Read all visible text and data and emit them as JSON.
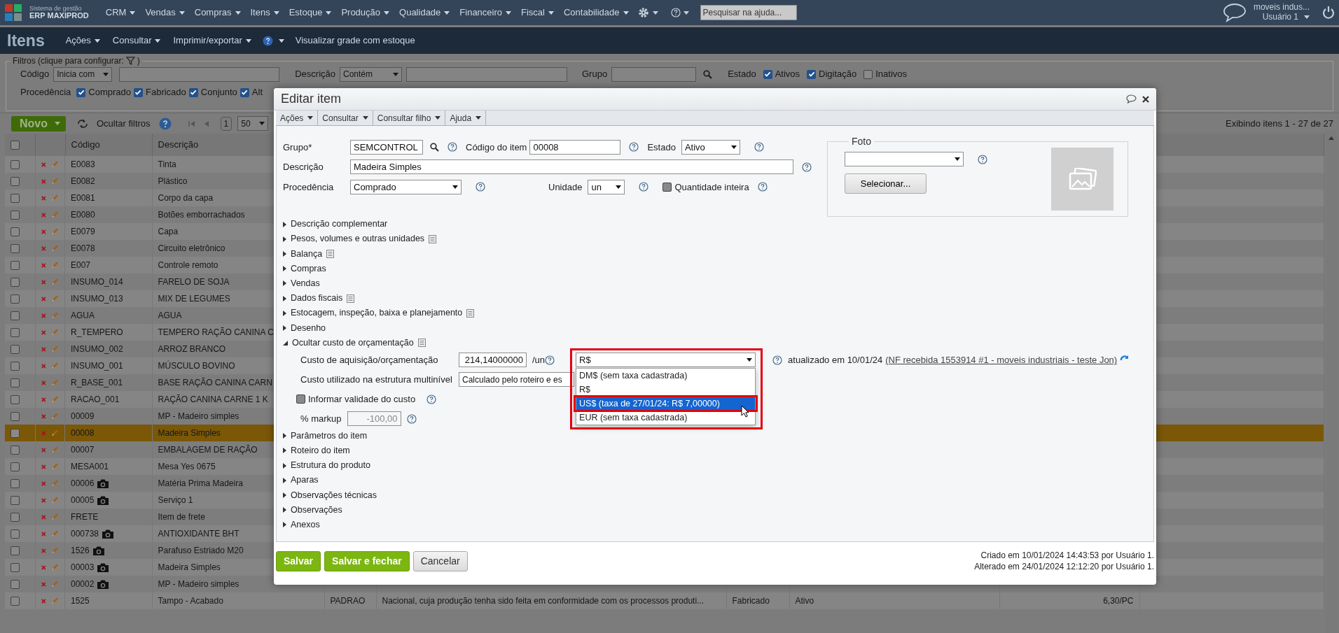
{
  "top_nav": {
    "brand_subtitle": "Sistema de gestão",
    "brand_name": "ERP MAXIPROD",
    "menus": [
      "CRM",
      "Vendas",
      "Compras",
      "Itens",
      "Estoque",
      "Produção",
      "Qualidade",
      "Financeiro",
      "Fiscal",
      "Contabilidade"
    ],
    "search": {
      "placeholder": "Pesquisar na ajuda..."
    },
    "company_link": "moveis indus...",
    "user": "Usuário 1"
  },
  "page_header": {
    "title": "Itens",
    "menus": [
      {
        "kind": "menu",
        "label": "Ações"
      },
      {
        "kind": "menu",
        "label": "Consultar"
      },
      {
        "kind": "menu",
        "label": "Imprimir/exportar"
      },
      {
        "kind": "help"
      },
      {
        "kind": "link",
        "label": "Visualizar grade com estoque"
      }
    ]
  },
  "filters": {
    "legend": "Filtros (clique para configurar:",
    "legend_end": ")",
    "code": {
      "label": "Código",
      "operator": "Inicia com"
    },
    "description": {
      "label": "Descrição",
      "operator": "Contém"
    },
    "group": {
      "label": "Grupo"
    },
    "status": {
      "label": "Estado",
      "options": [
        {
          "label": "Ativos",
          "checked": true
        },
        {
          "label": "Digitação",
          "checked": true
        },
        {
          "label": "Inativos",
          "checked": false
        }
      ]
    },
    "origin": {
      "label": "Procedência",
      "options": [
        {
          "label": "Comprado",
          "checked": true
        },
        {
          "label": "Fabricado",
          "checked": true
        },
        {
          "label": "Conjunto",
          "checked": true
        },
        {
          "label": "Alt",
          "checked": true
        }
      ]
    }
  },
  "toolbar": {
    "new_button": "Novo",
    "hide_filters": "Ocultar filtros",
    "page": "1",
    "page_size": "50",
    "summary": "Exibindo itens 1 - 27 de 27"
  },
  "table": {
    "header_checked": false,
    "columns": [
      "Código",
      "Descrição"
    ],
    "rows": [
      {
        "code": "E0083",
        "description": "Tinta",
        "photo": false,
        "checked": false,
        "selected": false
      },
      {
        "code": "E0082",
        "description": "Plástico",
        "photo": false,
        "checked": false,
        "selected": false
      },
      {
        "code": "E0081",
        "description": "Corpo da capa",
        "photo": false,
        "checked": false,
        "selected": false
      },
      {
        "code": "E0080",
        "description": "Botões emborrachados",
        "photo": false,
        "checked": false,
        "selected": false
      },
      {
        "code": "E0079",
        "description": "Capa",
        "photo": false,
        "checked": false,
        "selected": false
      },
      {
        "code": "E0078",
        "description": "Circuito eletrônico",
        "photo": false,
        "checked": false,
        "selected": false
      },
      {
        "code": "E007",
        "description": "Controle remoto",
        "photo": false,
        "checked": false,
        "selected": false
      },
      {
        "code": "INSUMO_014",
        "description": "FARELO DE SOJA",
        "photo": false,
        "checked": false,
        "selected": false
      },
      {
        "code": "INSUMO_013",
        "description": "MIX DE LEGUMES",
        "photo": false,
        "checked": false,
        "selected": false
      },
      {
        "code": "AGUA",
        "description": "AGUA",
        "photo": false,
        "checked": false,
        "selected": false
      },
      {
        "code": "R_TEMPERO",
        "description": "TEMPERO RAÇÃO CANINA C",
        "photo": false,
        "checked": false,
        "selected": false
      },
      {
        "code": "INSUMO_002",
        "description": "ARROZ BRANCO",
        "photo": false,
        "checked": false,
        "selected": false
      },
      {
        "code": "INSUMO_001",
        "description": "MÚSCULO BOVINO",
        "photo": false,
        "checked": false,
        "selected": false
      },
      {
        "code": "R_BASE_001",
        "description": "BASE RAÇÃO CANINA CARN",
        "photo": false,
        "checked": false,
        "selected": false
      },
      {
        "code": "RACAO_001",
        "description": "RAÇÃO CANINA CARNE 1 K",
        "photo": false,
        "checked": false,
        "selected": false
      },
      {
        "code": "00009",
        "description": "MP - Madeiro simples",
        "photo": false,
        "checked": false,
        "selected": false
      },
      {
        "code": "00008",
        "description": "Madeira Simples",
        "photo": false,
        "checked": false,
        "selected": true
      },
      {
        "code": "00007",
        "description": "EMBALAGEM DE RAÇÃO",
        "photo": false,
        "checked": false,
        "selected": false
      },
      {
        "code": "MESA001",
        "description": "Mesa Yes 0675",
        "photo": false,
        "checked": false,
        "selected": false
      },
      {
        "code": "00006",
        "description": "Matéria Prima Madeira",
        "photo": true,
        "checked": false,
        "selected": false
      },
      {
        "code": "00005",
        "description": "Serviço 1",
        "photo": true,
        "checked": false,
        "selected": false
      },
      {
        "code": "FRETE",
        "description": "Item de frete",
        "photo": false,
        "checked": false,
        "selected": false
      },
      {
        "code": "000738",
        "description": "ANTIOXIDANTE BHT",
        "photo": true,
        "checked": false,
        "selected": false
      },
      {
        "code": "1526",
        "description": "Parafuso Estriado M20",
        "photo": true,
        "checked": false,
        "selected": false
      },
      {
        "code": "00003",
        "description": "Madeira Simples",
        "photo": true,
        "checked": false,
        "selected": false
      },
      {
        "code": "00002",
        "description": "MP - Madeiro simples",
        "photo": true,
        "checked": false,
        "selected": false
      },
      {
        "code": "1525",
        "description": "Tampo - Acabado",
        "photo": false,
        "checked": false,
        "selected": false,
        "column_5": "PADRAO",
        "column_6": "Nacional, cuja produção tenha sido feita em conformidade com os processos produti...",
        "column_7": "Fabricado",
        "column_8": "Ativo",
        "column_9": "6,30/PC"
      }
    ]
  },
  "dialog": {
    "title": "Editar item",
    "menus": [
      "Ações",
      "Consultar",
      "Consultar filho",
      "Ajuda"
    ],
    "form": {
      "group": {
        "label": "Grupo*",
        "value": "SEMCONTROL"
      },
      "item_code": {
        "label": "Código do item",
        "value": "00008"
      },
      "status": {
        "label": "Estado",
        "value": "Ativo"
      },
      "description": {
        "label": "Descrição",
        "value": "Madeira Simples"
      },
      "origin": {
        "label": "Procedência",
        "value": "Comprado"
      },
      "unit": {
        "label": "Unidade",
        "value": "un"
      },
      "whole_quantity": {
        "label": "Quantidade inteira",
        "checked": false
      }
    },
    "photo": {
      "legend": "Foto",
      "button": "Selecionar..."
    },
    "sections_before": [
      {
        "label": "Descrição complementar",
        "note": false,
        "expanded": false
      },
      {
        "label": "Pesos, volumes e outras unidades",
        "note": true,
        "expanded": false
      },
      {
        "label": "Balança",
        "note": true,
        "expanded": false
      },
      {
        "label": "Compras",
        "note": false,
        "expanded": false
      },
      {
        "label": "Vendas",
        "note": false,
        "expanded": false
      },
      {
        "label": "Dados fiscais",
        "note": true,
        "expanded": false
      },
      {
        "label": "Estocagem, inspeção, baixa e planejamento",
        "note": true,
        "expanded": false
      },
      {
        "label": "Desenho",
        "note": false,
        "expanded": false
      }
    ],
    "cost_section": {
      "label": "Ocultar custo de orçamentação",
      "note": true,
      "expanded": true,
      "acquisition": {
        "label": "Custo de aquisição/orçamentação",
        "value": "214,14000000",
        "unit": "/un",
        "currency": "R$",
        "expanded": true,
        "options": [
          {
            "label": "DM$ (sem taxa cadastrada)",
            "selected": false
          },
          {
            "label": "R$",
            "selected": false
          },
          {
            "label": "US$ (taxa de 27/01/24: R$ 7,00000)",
            "selected": true
          },
          {
            "label": "EUR (sem taxa cadastrada)",
            "selected": false
          }
        ],
        "updated": "atualizado em 10/01/24",
        "source_link": "(NF recebida 1553914 #1 - moveis industriais - teste Jon)"
      },
      "multilevel": {
        "label": "Custo utilizado na estrutura multinível",
        "value": "Calculado pelo roteiro e es"
      },
      "validity": {
        "label": "Informar validade do custo",
        "checked": false
      },
      "markup": {
        "label": "% markup",
        "value": "-100,00",
        "disabled": true
      }
    },
    "sections_after": [
      {
        "label": "Parâmetros do item",
        "note": false,
        "expanded": false
      },
      {
        "label": "Roteiro do item",
        "note": false,
        "expanded": false
      },
      {
        "label": "Estrutura do produto",
        "note": false,
        "expanded": false
      },
      {
        "label": "Aparas",
        "note": false,
        "expanded": false
      },
      {
        "label": "Observações técnicas",
        "note": false,
        "expanded": false
      },
      {
        "label": "Observações",
        "note": false,
        "expanded": false
      },
      {
        "label": "Anexos",
        "note": false,
        "expanded": false
      }
    ],
    "buttons": [
      {
        "kind": "primary",
        "label": "Salvar"
      },
      {
        "kind": "primary",
        "label": "Salvar e fechar"
      },
      {
        "kind": "secondary",
        "label": "Cancelar"
      }
    ],
    "audit": [
      "Criado em 10/01/2024 14:43:53 por Usuário 1.",
      "Alterado em 24/01/2024 12:12:20 por Usuário 1."
    ]
  }
}
